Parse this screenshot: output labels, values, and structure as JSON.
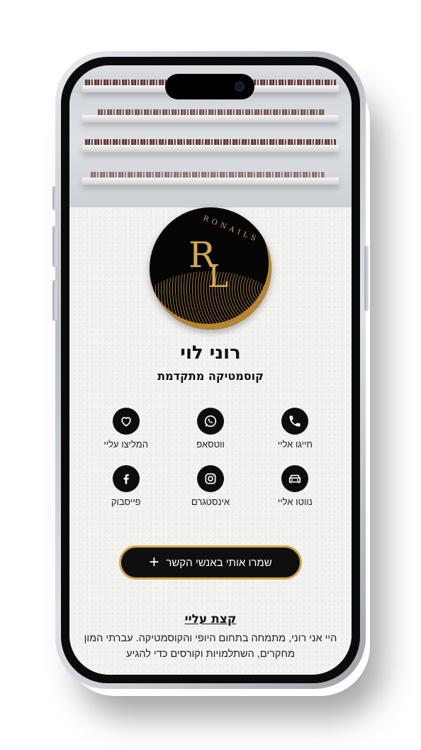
{
  "profile": {
    "name": "רוני לוי",
    "title": "קוסמטיקה מתקדמת",
    "logo_brand": "RONAILS",
    "logo_initial_1": "R",
    "logo_initial_2": "L"
  },
  "actions": [
    {
      "label": "חייגו אליי",
      "icon": "phone-icon"
    },
    {
      "label": "ווטסאפ",
      "icon": "whatsapp-icon"
    },
    {
      "label": "המליצו עליי",
      "icon": "heart-icon"
    },
    {
      "label": "נווטו אליי",
      "icon": "car-icon"
    },
    {
      "label": "אינסטגרם",
      "icon": "instagram-icon"
    },
    {
      "label": "פייסבוק",
      "icon": "facebook-icon"
    }
  ],
  "save_button": {
    "label": "שמרו אותי באנשי הקשר",
    "icon": "plus-icon"
  },
  "about": {
    "heading": "קצת עליי",
    "text": "היי אני רוני, מתמחה בתחום היופי והקוסמטיקה. עברתי המון מחקרים, השתלמויות וקורסים כדי להגיע"
  },
  "colors": {
    "accent": "#d6a63f",
    "dark": "#0d0d0d"
  }
}
